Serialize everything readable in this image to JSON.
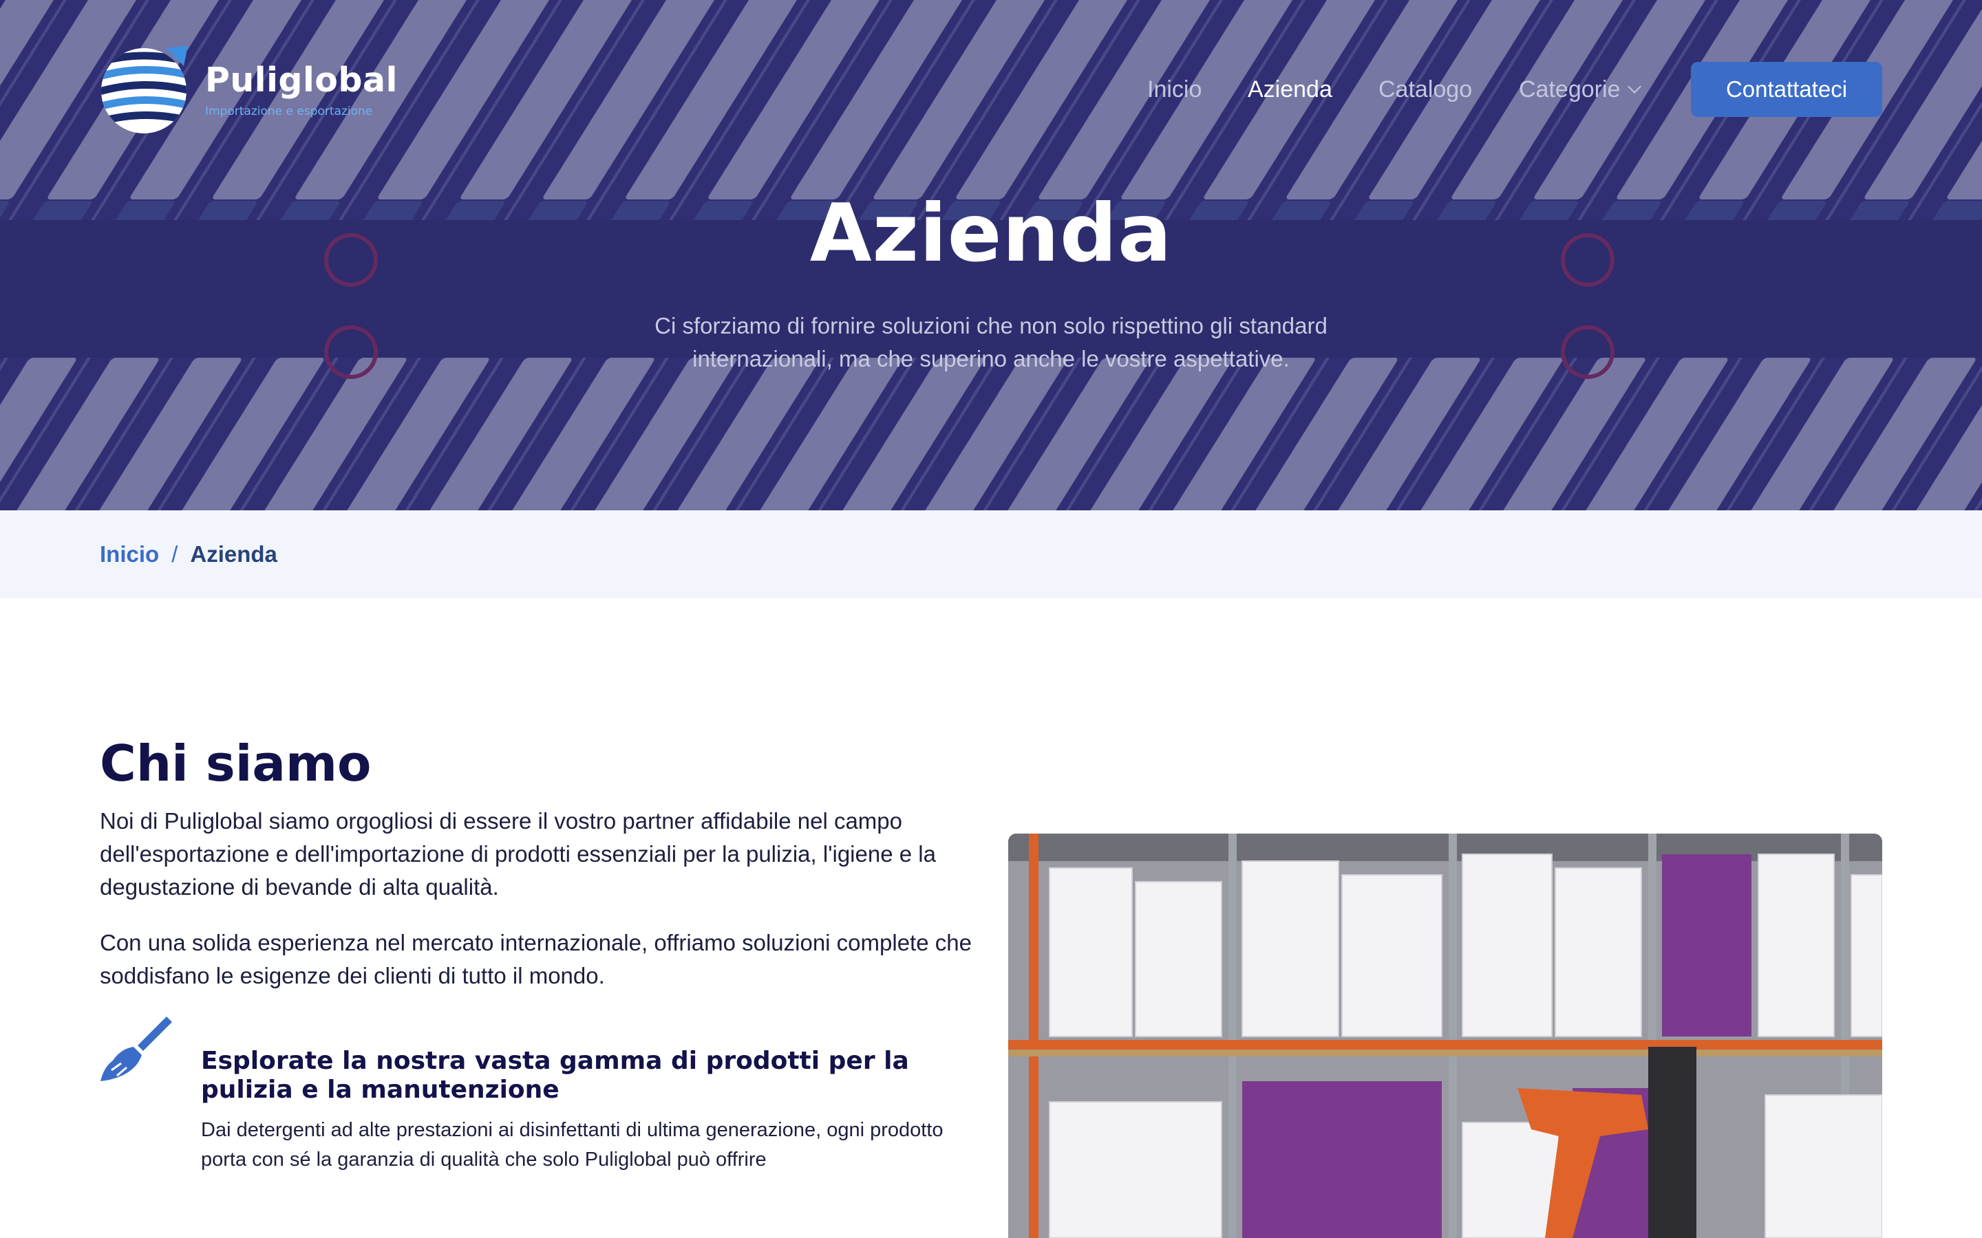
{
  "brand": {
    "name": "Puliglobal",
    "tagline": "Importazione e esportazione",
    "accent_color": "#3b6dc8",
    "navy_color": "#13124a"
  },
  "nav": {
    "items": [
      {
        "label": "Inicio",
        "active": false
      },
      {
        "label": "Azienda",
        "active": true
      },
      {
        "label": "Catalogo",
        "active": false
      },
      {
        "label": "Categorie",
        "active": false,
        "has_dropdown": true
      }
    ],
    "cta_label": "Contattateci"
  },
  "hero": {
    "title": "Azienda",
    "subtitle": "Ci sforziamo di fornire soluzioni che non solo rispettino gli standard internazionali, ma che superino anche le vostre aspettative."
  },
  "breadcrumb": {
    "home": "Inicio",
    "separator": "/",
    "current": "Azienda"
  },
  "about": {
    "title": "Chi siamo",
    "paragraphs": [
      "Noi di Puliglobal siamo orgogliosi di essere il vostro partner affidabile nel campo dell'esportazione e dell'importazione di prodotti essenziali per la pulizia, l'igiene e la degustazione di bevande di alta qualità.",
      "Con una solida esperienza nel mercato internazionale, offriamo soluzioni complete che soddisfano le esigenze dei clienti di tutto il mondo."
    ],
    "feature": {
      "icon": "broom-icon",
      "title": "Esplorate la nostra vasta gamma di prodotti per la pulizia e la manutenzione",
      "text": "Dai detergenti ad alte prestazioni ai disinfettanti di ultima generazione, ogni prodotto porta con sé la garanzia di qualità che solo Puliglobal può offrire"
    }
  }
}
